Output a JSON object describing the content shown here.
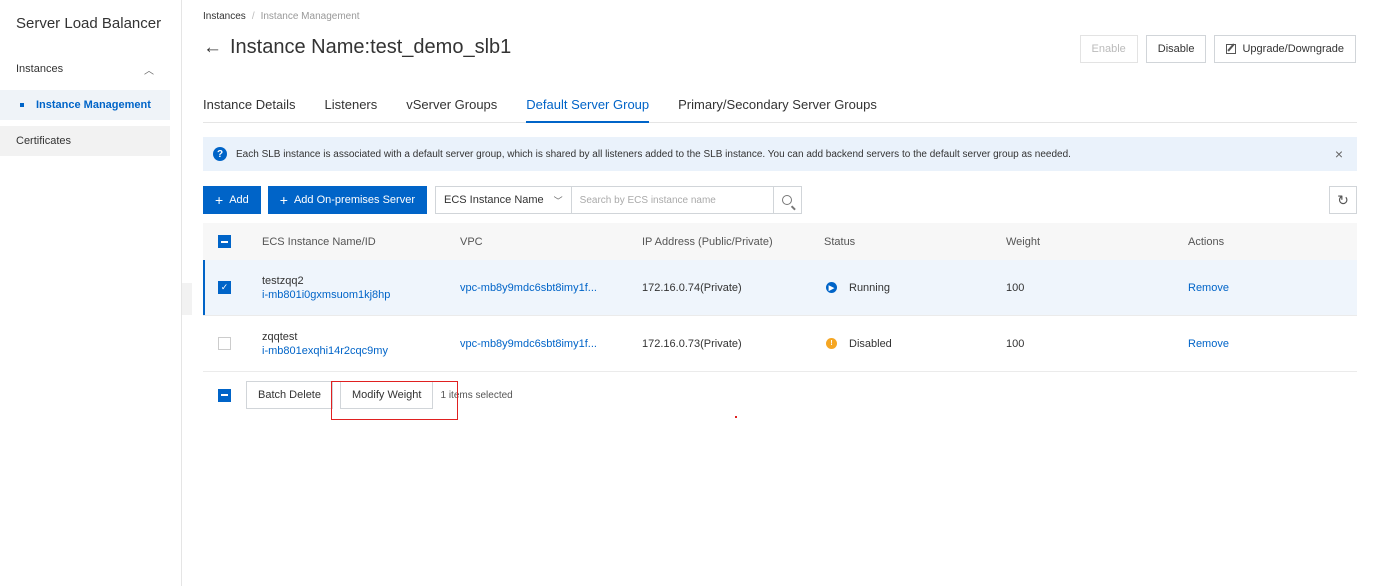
{
  "sidebar": {
    "title": "Server Load Balancer",
    "group_label": "Instances",
    "active_item": "Instance Management",
    "item_certificates": "Certificates"
  },
  "breadcrumb": {
    "root": "Instances",
    "separator": "/",
    "current": "Instance Management"
  },
  "page": {
    "back_arrow": "←",
    "title": "Instance Name:test_demo_slb1"
  },
  "actions": {
    "enable": "Enable",
    "disable": "Disable",
    "upgrade": "Upgrade/Downgrade"
  },
  "tabs": [
    {
      "label": "Instance Details"
    },
    {
      "label": "Listeners"
    },
    {
      "label": "vServer Groups"
    },
    {
      "label": "Default Server Group",
      "active": true
    },
    {
      "label": "Primary/Secondary Server Groups"
    }
  ],
  "alert": {
    "text": "Each SLB instance is associated with a default server group, which is shared by all listeners added to the SLB instance. You can add backend servers to the default server group as needed.",
    "close": "×"
  },
  "toolbar": {
    "add": "Add",
    "add_onprem": "Add On-premises Server",
    "filter_select": "ECS Instance Name",
    "search_placeholder": "Search by ECS instance name"
  },
  "table": {
    "headers": {
      "name": "ECS Instance Name/ID",
      "vpc": "VPC",
      "ip": "IP Address (Public/Private)",
      "status": "Status",
      "weight": "Weight",
      "actions": "Actions"
    },
    "rows": [
      {
        "name": "testzqq2",
        "id": "i-mb801i0gxmsuom1kj8hp",
        "vpc": "vpc-mb8y9mdc6sbt8imy1f...",
        "ip": "172.16.0.74(Private)",
        "status": "Running",
        "weight": "100",
        "action": "Remove",
        "selected": true
      },
      {
        "name": "zqqtest",
        "id": "i-mb801exqhi14r2cqc9my",
        "vpc": "vpc-mb8y9mdc6sbt8imy1f...",
        "ip": "172.16.0.73(Private)",
        "status": "Disabled",
        "weight": "100",
        "action": "Remove",
        "selected": false
      }
    ]
  },
  "batch": {
    "delete": "Batch Delete",
    "modify": "Modify Weight",
    "selected_text": "1 items selected"
  },
  "colors": {
    "primary": "#0064c8",
    "running": "#0064c8",
    "disabled": "#f5a623",
    "highlight": "#e02020"
  }
}
